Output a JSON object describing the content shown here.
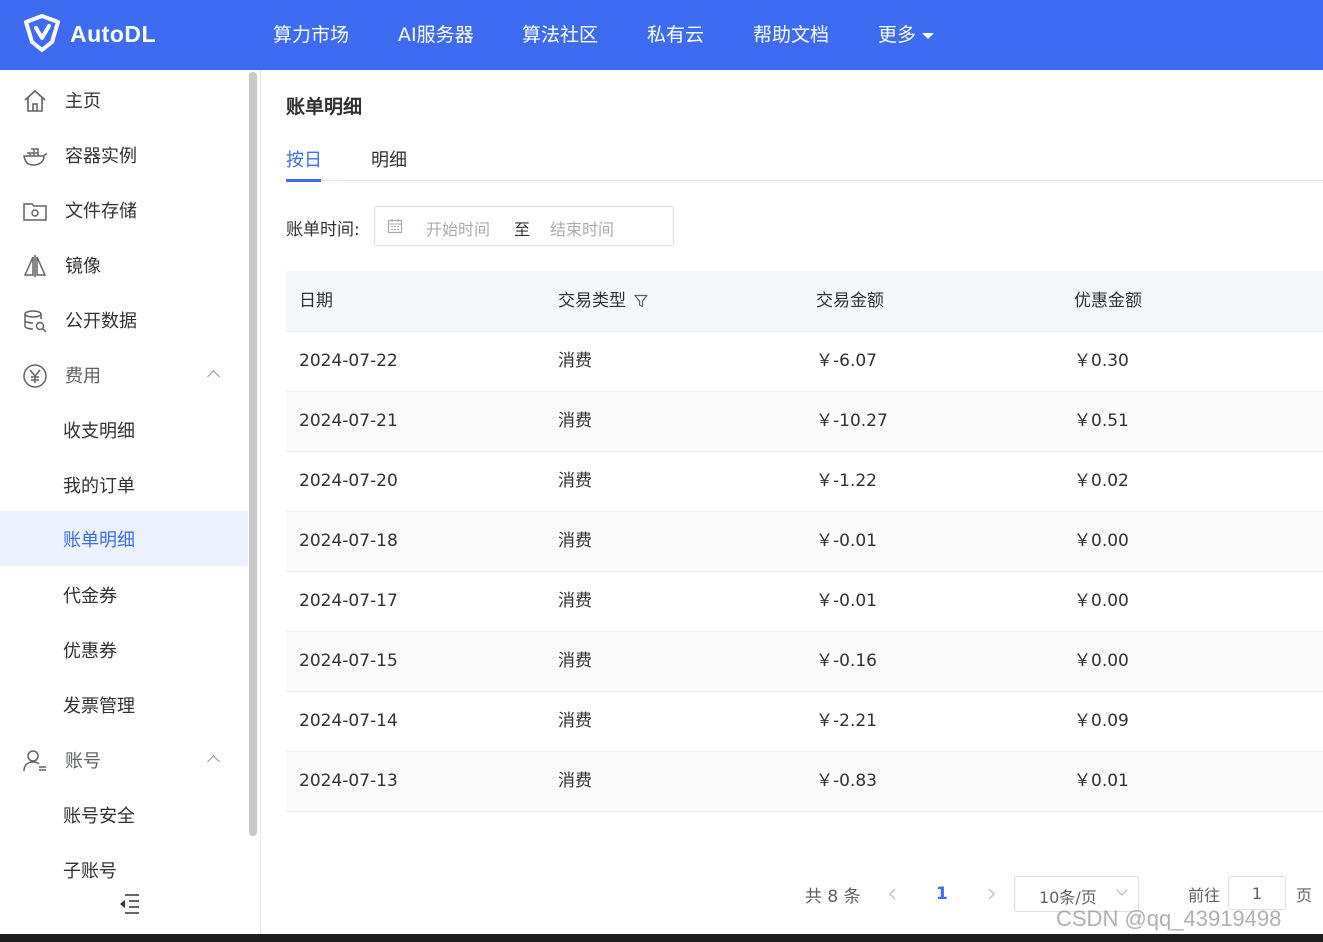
{
  "brand": {
    "name": "AutoDL"
  },
  "nav": [
    {
      "label": "算力市场"
    },
    {
      "label": "AI服务器"
    },
    {
      "label": "算法社区"
    },
    {
      "label": "私有云"
    },
    {
      "label": "帮助文档"
    },
    {
      "label": "更多"
    }
  ],
  "sidebar": {
    "home": "主页",
    "containers": "容器实例",
    "storage": "文件存储",
    "images": "镜像",
    "datasets": "公开数据",
    "billing": "费用",
    "billing_items": [
      "收支明细",
      "我的订单",
      "账单明细",
      "代金券",
      "优惠券",
      "发票管理"
    ],
    "account": "账号",
    "account_items": [
      "账号安全",
      "子账号"
    ]
  },
  "page": {
    "title": "账单明细",
    "tabs": [
      "按日",
      "明细"
    ],
    "filter_label": "账单时间:",
    "date_start_placeholder": "开始时间",
    "date_separator": "至",
    "date_end_placeholder": "结束时间"
  },
  "table": {
    "columns": [
      "日期",
      "交易类型",
      "交易金额",
      "优惠金额"
    ],
    "rows": [
      [
        "2024-07-22",
        "消费",
        "￥-6.07",
        "￥0.30"
      ],
      [
        "2024-07-21",
        "消费",
        "￥-10.27",
        "￥0.51"
      ],
      [
        "2024-07-20",
        "消费",
        "￥-1.22",
        "￥0.02"
      ],
      [
        "2024-07-18",
        "消费",
        "￥-0.01",
        "￥0.00"
      ],
      [
        "2024-07-17",
        "消费",
        "￥-0.01",
        "￥0.00"
      ],
      [
        "2024-07-15",
        "消费",
        "￥-0.16",
        "￥0.00"
      ],
      [
        "2024-07-14",
        "消费",
        "￥-2.21",
        "￥0.09"
      ],
      [
        "2024-07-13",
        "消费",
        "￥-0.83",
        "￥0.01"
      ]
    ]
  },
  "pagination": {
    "total": "共 8 条",
    "current_page": "1",
    "page_size": "10条/页",
    "goto_prefix": "前往",
    "goto_value": "1",
    "goto_suffix": "页"
  },
  "watermark": "CSDN @qq_43919498",
  "colors": {
    "brand": "#3d6cf2",
    "active_bg": "#ecf2ff"
  }
}
